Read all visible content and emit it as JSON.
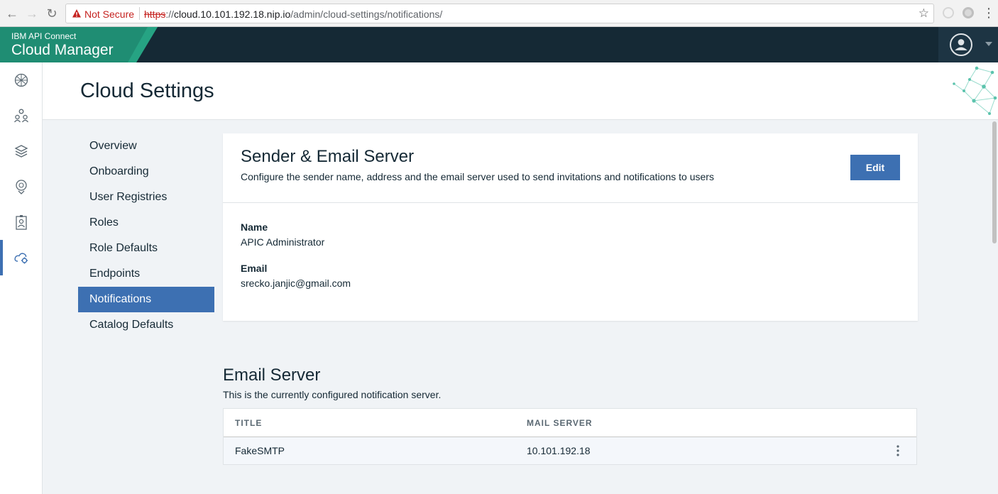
{
  "browser": {
    "security_label": "Not Secure",
    "url_protocol": "https",
    "url_sep": "://",
    "url_host": "cloud.10.101.192.18.nip.io",
    "url_path": "/admin/cloud-settings/notifications/"
  },
  "header": {
    "brand_sub": "IBM API Connect",
    "brand_title": "Cloud Manager"
  },
  "rail": [
    {
      "name": "dashboard-icon"
    },
    {
      "name": "organizations-icon"
    },
    {
      "name": "resources-icon"
    },
    {
      "name": "topology-icon"
    },
    {
      "name": "member-badge-icon"
    },
    {
      "name": "cloud-settings-icon"
    }
  ],
  "page": {
    "title": "Cloud Settings"
  },
  "settings_nav": [
    {
      "label": "Overview"
    },
    {
      "label": "Onboarding"
    },
    {
      "label": "User Registries"
    },
    {
      "label": "Roles"
    },
    {
      "label": "Role Defaults"
    },
    {
      "label": "Endpoints"
    },
    {
      "label": "Notifications"
    },
    {
      "label": "Catalog Defaults"
    }
  ],
  "sender": {
    "title": "Sender & Email Server",
    "description": "Configure the sender name, address and the email server used to send invitations and notifications to users",
    "edit_label": "Edit",
    "name_label": "Name",
    "name_value": "APIC Administrator",
    "email_label": "Email",
    "email_value": "srecko.janjic@gmail.com"
  },
  "email_server": {
    "title": "Email Server",
    "description": "This is the currently configured notification server.",
    "columns": [
      "TITLE",
      "MAIL SERVER"
    ],
    "rows": [
      {
        "title": "FakeSMTP",
        "mail_server": "10.101.192.18"
      }
    ]
  },
  "colors": {
    "accent": "#3d70b2",
    "header": "#152935",
    "brand_green": "#1f8d73"
  }
}
